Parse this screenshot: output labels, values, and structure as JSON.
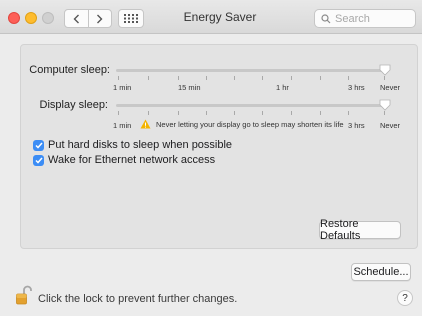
{
  "window": {
    "title": "Energy Saver",
    "search_placeholder": "Search"
  },
  "computer_sleep": {
    "label": "Computer sleep:",
    "value": "Never",
    "tick_labels": [
      "1 min",
      "15 min",
      "1 hr",
      "3 hrs",
      "Never"
    ]
  },
  "display_sleep": {
    "label": "Display sleep:",
    "value": "Never",
    "tick_labels": [
      "1 min",
      "3 hrs",
      "Never"
    ],
    "warning": "Never letting your display go to sleep may shorten its life"
  },
  "options": [
    {
      "label": "Put hard disks to sleep when possible",
      "checked": true
    },
    {
      "label": "Wake for Ethernet network access",
      "checked": true
    }
  ],
  "buttons": {
    "restore_defaults": "Restore Defaults",
    "schedule": "Schedule..."
  },
  "footer": {
    "lock_text": "Click the lock to prevent further changes.",
    "help": "?"
  },
  "colors": {
    "accent": "#3c8df5",
    "warning": "#f4b400"
  }
}
